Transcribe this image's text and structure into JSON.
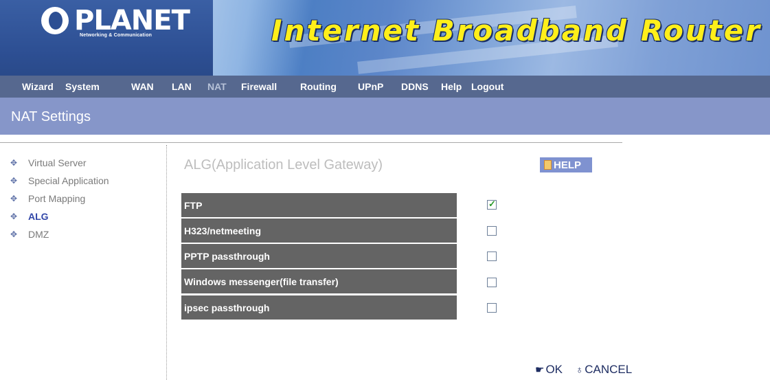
{
  "header": {
    "logo_text": "PLANET",
    "logo_subtitle": "Networking & Communication",
    "product_title": "Internet Broadband Router"
  },
  "menu": [
    {
      "label": "Wizard",
      "active": false
    },
    {
      "label": "System",
      "active": false
    },
    {
      "label": "WAN",
      "active": false
    },
    {
      "label": "LAN",
      "active": false
    },
    {
      "label": "NAT",
      "active": true
    },
    {
      "label": "Firewall",
      "active": false
    },
    {
      "label": "Routing",
      "active": false
    },
    {
      "label": "UPnP",
      "active": false
    },
    {
      "label": "DDNS",
      "active": false
    },
    {
      "label": "Help",
      "active": false
    },
    {
      "label": "Logout",
      "active": false
    }
  ],
  "page_title": "NAT Settings",
  "sidebar": {
    "items": [
      {
        "label": "Virtual Server",
        "active": false
      },
      {
        "label": "Special Application",
        "active": false
      },
      {
        "label": "Port Mapping",
        "active": false
      },
      {
        "label": "ALG",
        "active": true
      },
      {
        "label": "DMZ",
        "active": false
      }
    ]
  },
  "content": {
    "title": "ALG(Application Level Gateway)",
    "help_label": "HELP",
    "rows": [
      {
        "label": "FTP",
        "checked": true
      },
      {
        "label": "H323/netmeeting",
        "checked": false
      },
      {
        "label": "PPTP passthrough",
        "checked": false
      },
      {
        "label": "Windows messenger(file transfer)",
        "checked": false
      },
      {
        "label": "ipsec passthrough",
        "checked": false
      }
    ],
    "ok_label": "OK",
    "cancel_label": "CANCEL"
  },
  "colors": {
    "menu_bar": "#56688f",
    "title_bar": "#8696c9",
    "row_background": "#646464",
    "product_title": "#ffef1a"
  }
}
